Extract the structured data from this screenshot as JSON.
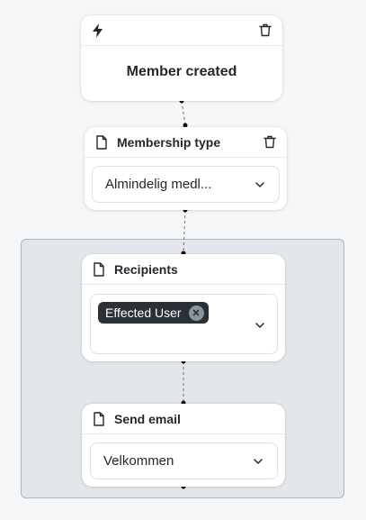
{
  "nodes": {
    "trigger": {
      "title": "Member created",
      "icon": "lightning-icon"
    },
    "membership_type": {
      "title": "Membership type",
      "icon": "document-icon",
      "selected_value": "Almindelig medl..."
    },
    "recipients": {
      "title": "Recipients",
      "icon": "document-icon",
      "chips": [
        "Effected User"
      ]
    },
    "send_email": {
      "title": "Send email",
      "icon": "document-icon",
      "selected_value": "Velkommen"
    }
  },
  "colors": {
    "background": "#f5f6f7",
    "group_fill": "#e3e7eb",
    "group_border": "#aeb6bf",
    "chip_bg": "#2b3037",
    "text": "#23272e"
  }
}
